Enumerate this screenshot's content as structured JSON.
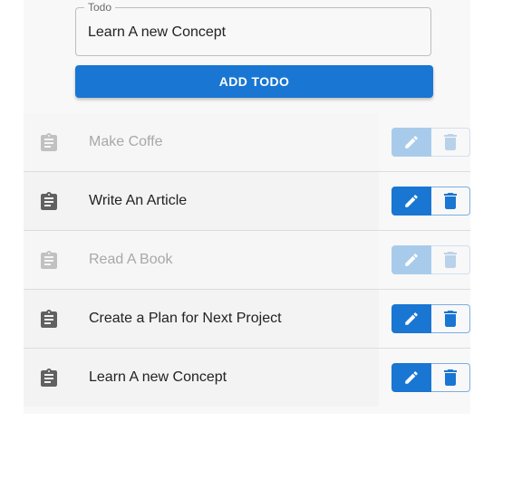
{
  "form": {
    "field_label": "Todo",
    "field_value": "Learn A new Concept",
    "add_button_label": "ADD TODO"
  },
  "todos": [
    {
      "text": "Make Coffe",
      "state": "disabled"
    },
    {
      "text": "Write An Article",
      "state": "active"
    },
    {
      "text": "Read A Book",
      "state": "disabled"
    },
    {
      "text": "Create a Plan for Next Project",
      "state": "active"
    },
    {
      "text": "Learn A new Concept",
      "state": "active"
    }
  ],
  "icons": {
    "item": "clipboard-icon",
    "edit": "pencil-icon",
    "delete": "trash-icon"
  },
  "colors": {
    "primary": "#1976d2",
    "primary_disabled": "#a9cbeb"
  }
}
